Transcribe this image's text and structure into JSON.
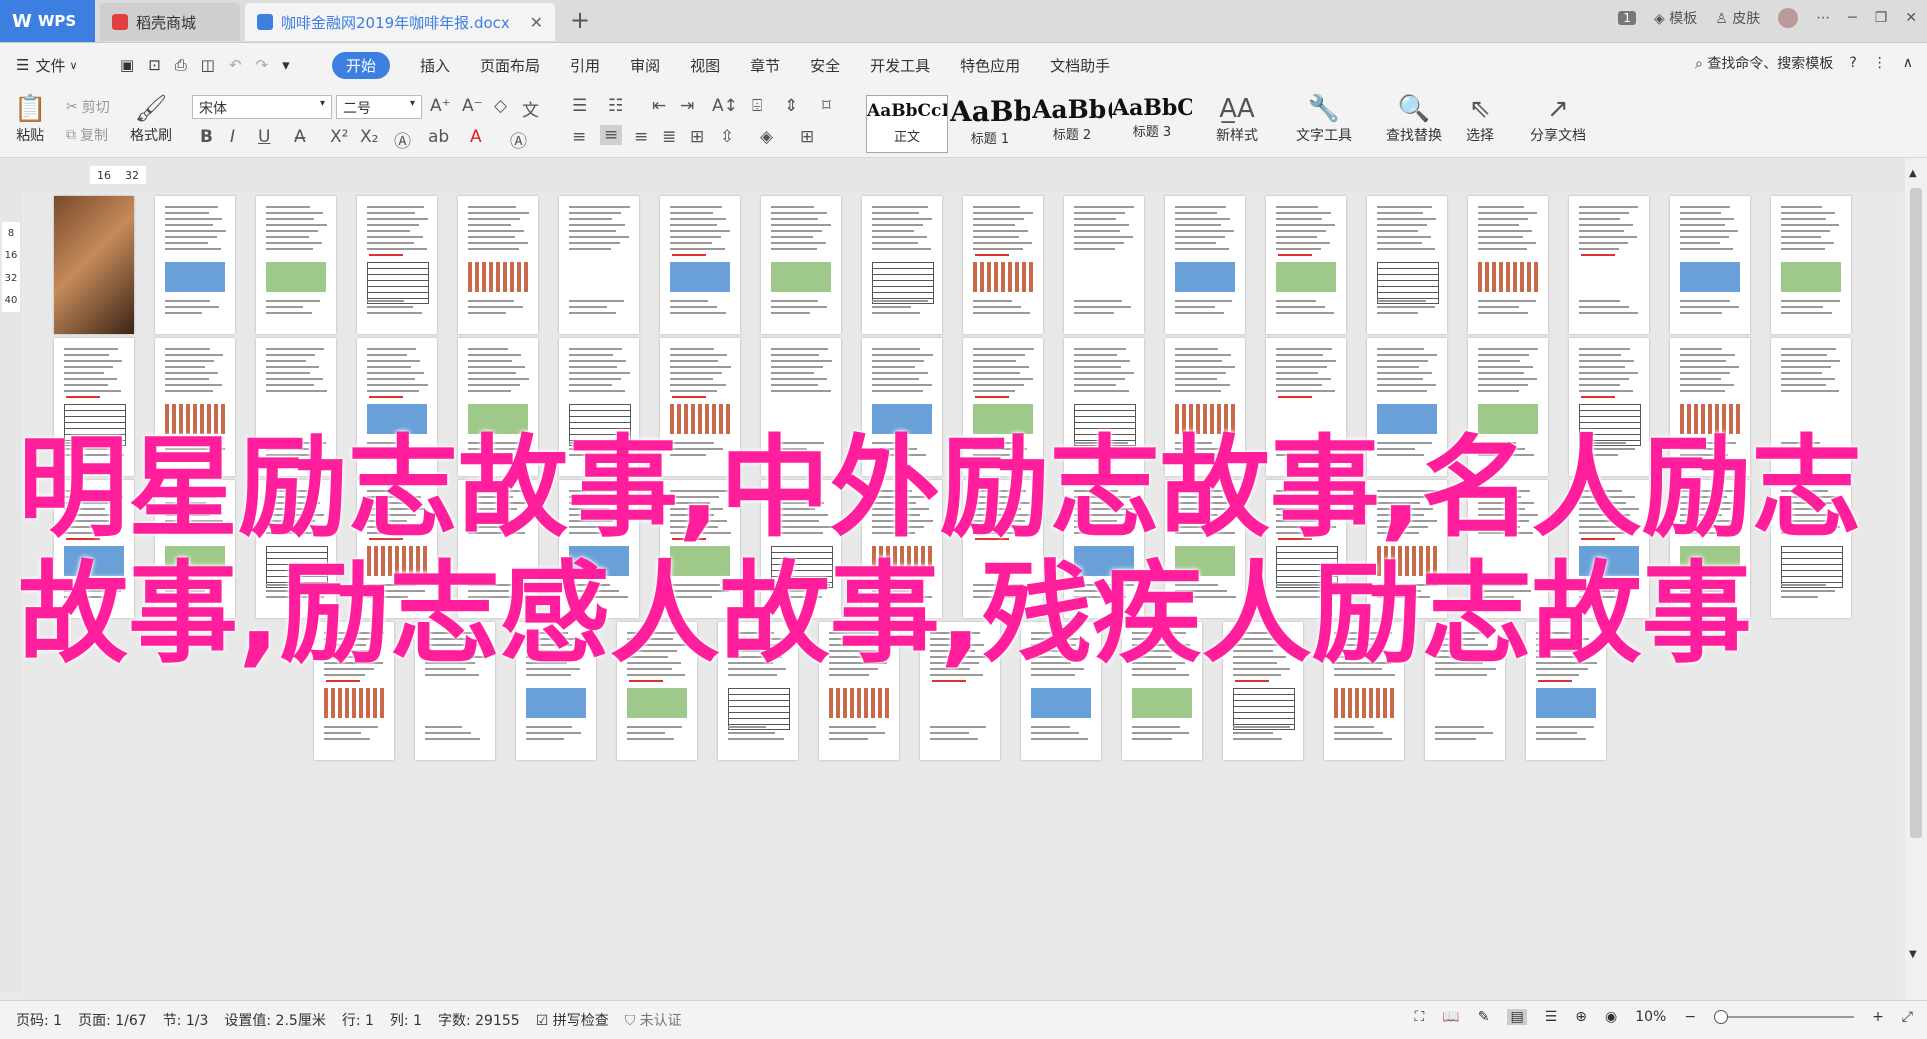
{
  "titlebar": {
    "tabs": [
      "WPS",
      "稻壳商城",
      "咖啡金融网2019年咖啡年报.docx"
    ],
    "page_badge": "1",
    "template_label": "模板",
    "skin_label": "皮肤"
  },
  "menubar": {
    "file_label": "文件",
    "items": [
      "开始",
      "插入",
      "页面布局",
      "引用",
      "审阅",
      "视图",
      "章节",
      "安全",
      "开发工具",
      "特色应用",
      "文档助手"
    ],
    "search_label": "查找命令、搜索模板"
  },
  "ribbon": {
    "paste_label": "粘贴",
    "cut_label": "剪切",
    "copy_label": "复制",
    "format_painter_label": "格式刷",
    "font_name": "宋体",
    "font_size": "二号",
    "styles": [
      {
        "preview": "AaBbCcDd",
        "name": "正文"
      },
      {
        "preview": "AaBb",
        "name": "标题 1"
      },
      {
        "preview": "AaBb(",
        "name": "标题 2"
      },
      {
        "preview": "AaBbC",
        "name": "标题 3"
      }
    ],
    "new_style_label": "新样式",
    "text_tools_label": "文字工具",
    "find_replace_label": "查找替换",
    "select_label": "选择",
    "share_label": "分享文档"
  },
  "ruler": {
    "marks": [
      "16",
      "32"
    ],
    "vmarks": [
      "8",
      "16",
      "32",
      "40"
    ]
  },
  "overlay_text": "明星励志故事,中外励志故事,名人励志\n故事,励志感人故事,残疾人励志故事",
  "statusbar": {
    "page_num": "页码: 1",
    "page": "页面: 1/67",
    "section": "节: 1/3",
    "setting": "设置值: 2.5厘米",
    "line": "行: 1",
    "col": "列: 1",
    "words": "字数: 29155",
    "spell": "拼写检查",
    "auth": "未认证",
    "zoom": "10%"
  }
}
